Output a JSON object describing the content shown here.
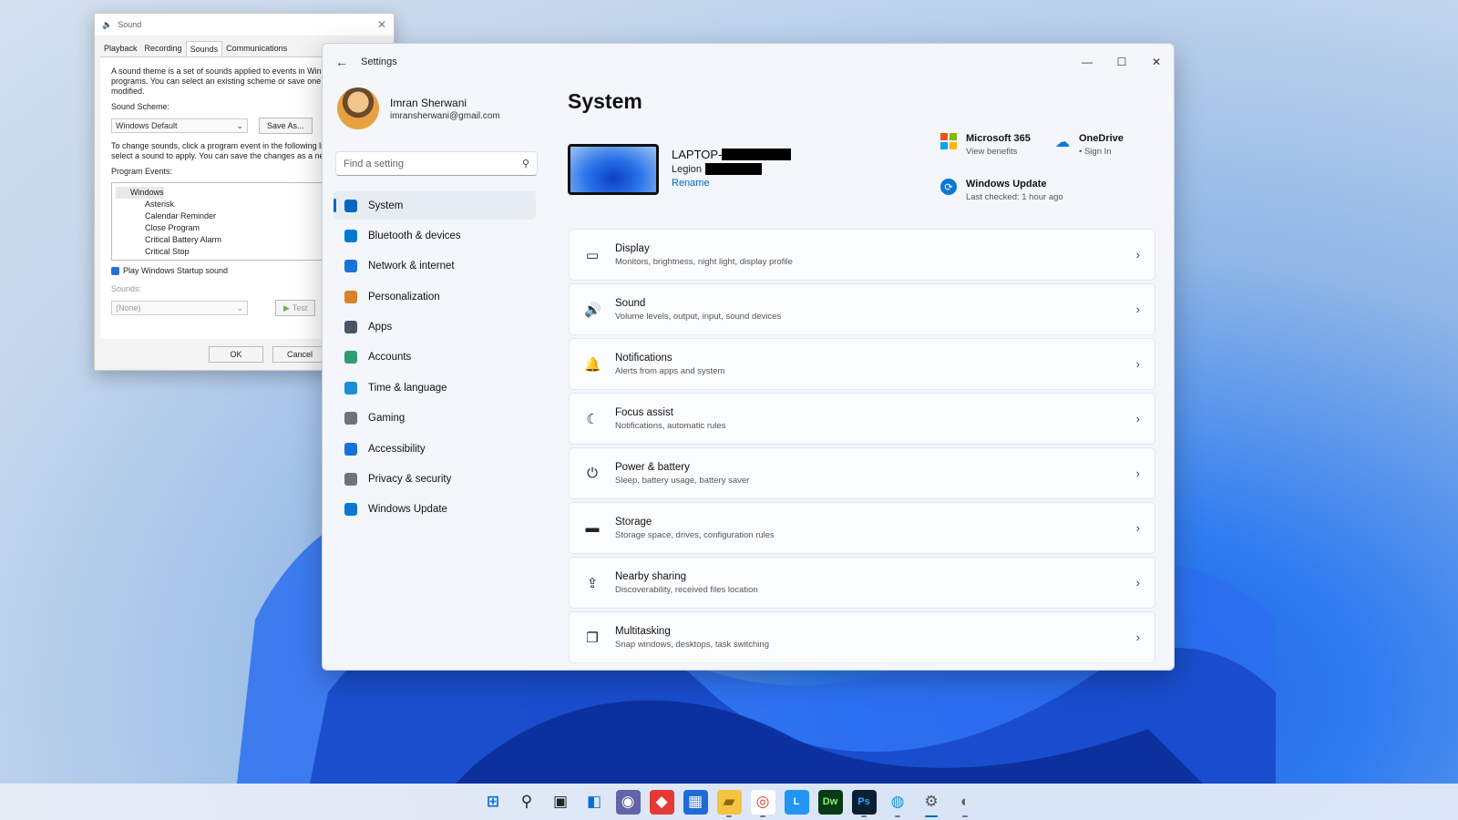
{
  "sound_dialog": {
    "title": "Sound",
    "tabs": [
      "Playback",
      "Recording",
      "Sounds",
      "Communications"
    ],
    "active_tab": "Sounds",
    "description": "A sound theme is a set of sounds applied to events in Windows and programs. You can select an existing scheme or save one you have modified.",
    "scheme_label": "Sound Scheme:",
    "scheme_value": "Windows Default",
    "save_as_label": "Save As...",
    "instructions": "To change sounds, click a program event in the following list and then select a sound to apply. You can save the changes as a new sound scheme.",
    "events_label": "Program Events:",
    "events": [
      "Windows",
      "Asterisk",
      "Calendar Reminder",
      "Close Program",
      "Critical Battery Alarm",
      "Critical Stop"
    ],
    "startup_label": "Play Windows Startup sound",
    "sounds_label": "Sounds:",
    "sounds_value": "(None)",
    "test_label": "Test",
    "ok_label": "OK",
    "cancel_label": "Cancel"
  },
  "settings": {
    "window_title": "Settings",
    "user_name": "Imran Sherwani",
    "user_email": "imransherwani@gmail.com",
    "search_placeholder": "Find a setting",
    "nav": [
      {
        "label": "System",
        "icon": "monitor-icon",
        "color": "#0067c0"
      },
      {
        "label": "Bluetooth & devices",
        "icon": "bluetooth-icon",
        "color": "#0078d4"
      },
      {
        "label": "Network & internet",
        "icon": "wifi-icon",
        "color": "#1a73d9"
      },
      {
        "label": "Personalization",
        "icon": "brush-icon",
        "color": "#d9822b"
      },
      {
        "label": "Apps",
        "icon": "apps-icon",
        "color": "#4a5568"
      },
      {
        "label": "Accounts",
        "icon": "person-icon",
        "color": "#2f9e6e"
      },
      {
        "label": "Time & language",
        "icon": "globe-clock-icon",
        "color": "#1a8fd9"
      },
      {
        "label": "Gaming",
        "icon": "gamepad-icon",
        "color": "#6b7280"
      },
      {
        "label": "Accessibility",
        "icon": "accessibility-icon",
        "color": "#1a6fd9"
      },
      {
        "label": "Privacy & security",
        "icon": "shield-icon",
        "color": "#6b7280"
      },
      {
        "label": "Windows Update",
        "icon": "update-icon",
        "color": "#0a78d4"
      }
    ],
    "page_title": "System",
    "device": {
      "name_prefix": "LAPTOP-",
      "model_prefix": "Legion",
      "rename_label": "Rename"
    },
    "quick": {
      "m365_title": "Microsoft 365",
      "m365_sub": "View benefits",
      "onedrive_title": "OneDrive",
      "onedrive_sub": "• Sign In",
      "update_title": "Windows Update",
      "update_sub": "Last checked: 1 hour ago"
    },
    "cards": [
      {
        "title": "Display",
        "sub": "Monitors, brightness, night light, display profile",
        "icon": "display-icon",
        "glyph": "▭"
      },
      {
        "title": "Sound",
        "sub": "Volume levels, output, input, sound devices",
        "icon": "speaker-icon",
        "glyph": "🔊"
      },
      {
        "title": "Notifications",
        "sub": "Alerts from apps and system",
        "icon": "bell-icon",
        "glyph": "🔔"
      },
      {
        "title": "Focus assist",
        "sub": "Notifications, automatic rules",
        "icon": "moon-icon",
        "glyph": "☾"
      },
      {
        "title": "Power & battery",
        "sub": "Sleep, battery usage, battery saver",
        "icon": "power-icon",
        "glyph": "⏻"
      },
      {
        "title": "Storage",
        "sub": "Storage space, drives, configuration rules",
        "icon": "storage-icon",
        "glyph": "▬"
      },
      {
        "title": "Nearby sharing",
        "sub": "Discoverability, received files location",
        "icon": "share-icon",
        "glyph": "⇪"
      },
      {
        "title": "Multitasking",
        "sub": "Snap windows, desktops, task switching",
        "icon": "multitask-icon",
        "glyph": "❐"
      }
    ]
  },
  "taskbar": [
    {
      "name": "start-icon",
      "glyph": "⊞",
      "bg": "transparent",
      "fg": "#0a6fd6"
    },
    {
      "name": "search-icon",
      "glyph": "⚲",
      "bg": "transparent",
      "fg": "#222"
    },
    {
      "name": "task-view-icon",
      "glyph": "▣",
      "bg": "transparent",
      "fg": "#222"
    },
    {
      "name": "widgets-icon",
      "glyph": "◧",
      "bg": "transparent",
      "fg": "#0a6fd6"
    },
    {
      "name": "chat-icon",
      "glyph": "◉",
      "bg": "#6264a7",
      "fg": "#fff"
    },
    {
      "name": "anydesk-icon",
      "glyph": "◆",
      "bg": "#e53935",
      "fg": "#fff"
    },
    {
      "name": "store-icon",
      "glyph": "▦",
      "bg": "#1e6bd6",
      "fg": "#fff"
    },
    {
      "name": "file-explorer-icon",
      "glyph": "▰",
      "bg": "#f4c33f",
      "fg": "#8a6a10"
    },
    {
      "name": "chrome-icon",
      "glyph": "◎",
      "bg": "#ffffff",
      "fg": "#db4437"
    },
    {
      "name": "l-app-icon",
      "glyph": "L",
      "bg": "#2196f3",
      "fg": "#fff"
    },
    {
      "name": "dreamweaver-icon",
      "glyph": "Dw",
      "bg": "#073b17",
      "fg": "#8ef07a"
    },
    {
      "name": "photoshop-icon",
      "glyph": "Ps",
      "bg": "#0b1f33",
      "fg": "#31a8ff"
    },
    {
      "name": "network-globe-icon",
      "glyph": "◍",
      "bg": "transparent",
      "fg": "#1a8fd9"
    },
    {
      "name": "settings-gear-icon",
      "glyph": "⚙",
      "bg": "transparent",
      "fg": "#555"
    },
    {
      "name": "sound-app-icon",
      "glyph": "◐",
      "bg": "transparent",
      "fg": "#666"
    }
  ],
  "colors": {
    "accent": "#0067c0",
    "link": "#0067c0"
  }
}
